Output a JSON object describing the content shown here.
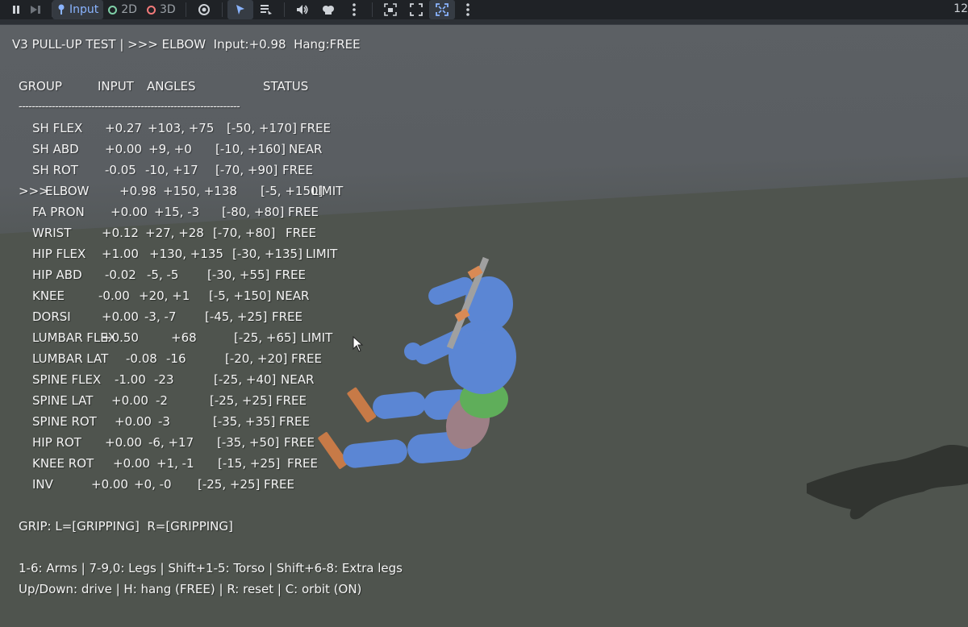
{
  "toolbar": {
    "input_label": "Input",
    "mode_2d_label": "2D",
    "mode_3d_label": "3D",
    "fps_text": "12",
    "colors": {
      "accent": "#8ab4ff",
      "ring_2d": "#7fd1a8",
      "ring_3d": "#f27a7a"
    },
    "icons": [
      "pause-icon",
      "step-icon",
      "input-icon",
      "visibility-icon",
      "select-pointer-icon",
      "list-icon",
      "audio-icon",
      "mute-icon",
      "more-icon",
      "camera-icon",
      "fullscreen-icon",
      "expand-icon",
      "more-icon"
    ]
  },
  "hud": {
    "title": "V3 PULL-UP TEST | >>> ELBOW  Input:+0.98  Hang:FREE",
    "headers": {
      "group": "GROUP",
      "input": "INPUT",
      "angles": "ANGLES",
      "status": "STATUS"
    },
    "divider": "-------------------------------------------------------------------",
    "rows": [
      {
        "marker": "",
        "group": "SH FLEX",
        "input": "+0.27",
        "angles": "+103, +75",
        "range": "[-50, +170]",
        "status": "FREE"
      },
      {
        "marker": "",
        "group": "SH ABD",
        "input": "+0.00",
        "angles": "+9, +0",
        "range": "[-10, +160]",
        "status": "NEAR"
      },
      {
        "marker": "",
        "group": "SH ROT",
        "input": "-0.05",
        "angles": "-10, +17",
        "range": "[-70, +90]",
        "status": "FREE"
      },
      {
        "marker": ">>>",
        "group": "ELBOW",
        "input": "+0.98",
        "angles": "+150, +138",
        "range": "[-5, +150]",
        "status": "LIMIT"
      },
      {
        "marker": "",
        "group": "FA PRON",
        "input": "+0.00",
        "angles": "+15, -3",
        "range": "[-80, +80]",
        "status": "FREE"
      },
      {
        "marker": "",
        "group": "WRIST",
        "input": "+0.12",
        "angles": "+27, +28",
        "range": "[-70, +80]",
        "status": "FREE"
      },
      {
        "marker": "",
        "group": "HIP FLEX",
        "input": "+1.00",
        "angles": "+130, +135",
        "range": "[-30, +135]",
        "status": "LIMIT"
      },
      {
        "marker": "",
        "group": "HIP ABD",
        "input": "-0.02",
        "angles": "-5, -5",
        "range": "[-30, +55]",
        "status": "FREE"
      },
      {
        "marker": "",
        "group": "KNEE",
        "input": "-0.00",
        "angles": "+20, +1",
        "range": "[-5, +150]",
        "status": "NEAR"
      },
      {
        "marker": "",
        "group": "DORSI",
        "input": "+0.00",
        "angles": "-3, -7",
        "range": "[-45, +25]",
        "status": "FREE"
      },
      {
        "marker": "",
        "group": "LUMBAR FLEX",
        "input": "+0.50",
        "angles": "+68",
        "range": "[-25, +65]",
        "status": "LIMIT"
      },
      {
        "marker": "",
        "group": "LUMBAR LAT",
        "input": "-0.08",
        "angles": "-16",
        "range": "[-20, +20]",
        "status": "FREE"
      },
      {
        "marker": "",
        "group": "SPINE FLEX",
        "input": "-1.00",
        "angles": "-23",
        "range": "[-25, +40]",
        "status": "NEAR"
      },
      {
        "marker": "",
        "group": "SPINE LAT",
        "input": "+0.00",
        "angles": "-2",
        "range": "[-25, +25]",
        "status": "FREE"
      },
      {
        "marker": "",
        "group": "SPINE ROT",
        "input": "+0.00",
        "angles": "-3",
        "range": "[-35, +35]",
        "status": "FREE"
      },
      {
        "marker": "",
        "group": "HIP ROT",
        "input": "+0.00",
        "angles": "-6, +17",
        "range": "[-35, +50]",
        "status": "FREE"
      },
      {
        "marker": "",
        "group": "KNEE ROT",
        "input": "+0.00",
        "angles": "+1, -1",
        "range": "[-15, +25]",
        "status": "FREE"
      },
      {
        "marker": "",
        "group": "INV",
        "input": "+0.00",
        "angles": "+0, -0",
        "range": "[-25, +25]",
        "status": "FREE"
      }
    ],
    "grip": "GRIP: L=[GRIPPING]  R=[GRIPPING]",
    "help_line_1": "1-6: Arms | 7-9,0: Legs | Shift+1-5: Torso | Shift+6-8: Extra legs",
    "help_line_2": "Up/Down: drive | H: hang (FREE) | R: reset | C: orbit (ON)"
  },
  "scene": {
    "colors": {
      "body": "#5b86d4",
      "pelvis": "#5fae5a",
      "thigh": "#9d7f86",
      "bar": "#a0a0a0",
      "hands": "#d98a55"
    }
  }
}
